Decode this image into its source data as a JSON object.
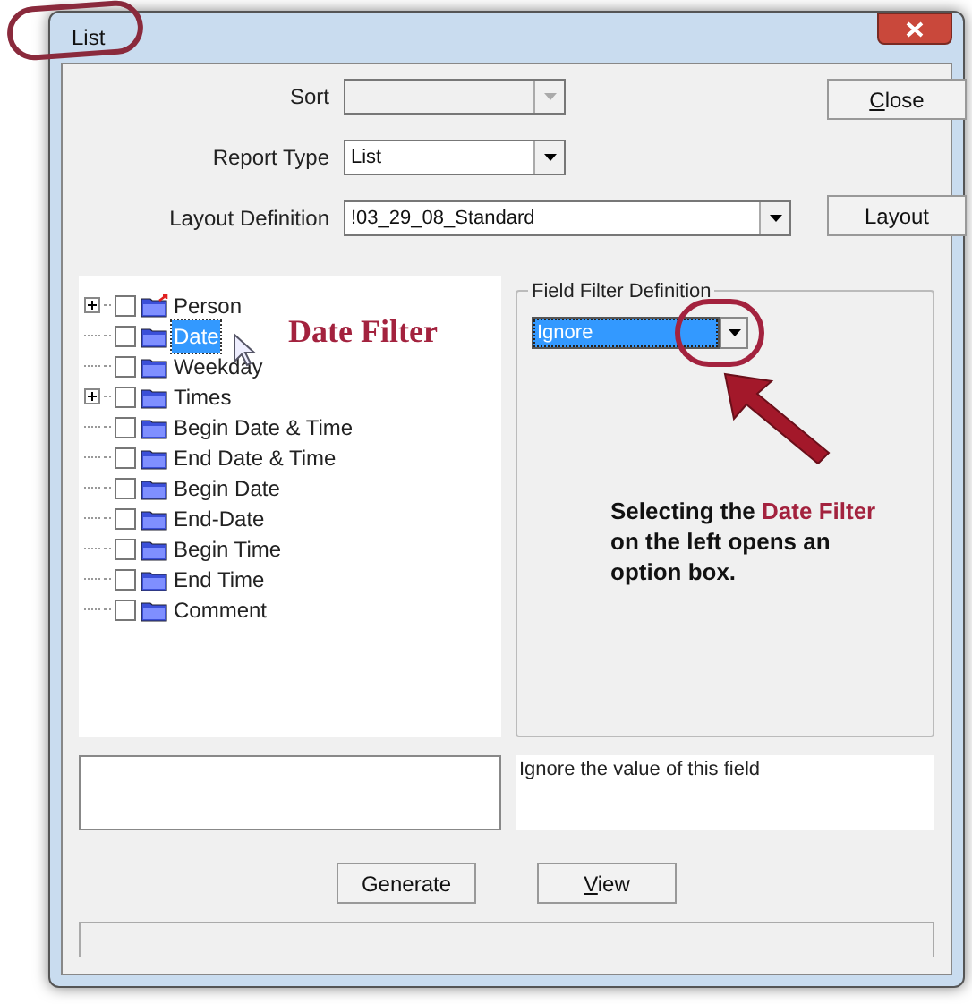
{
  "window": {
    "title": "List"
  },
  "sort": {
    "label": "Sort",
    "disabled": true
  },
  "report_type": {
    "label": "Report Type",
    "value": "List"
  },
  "layout_definition": {
    "label": "Layout Definition",
    "value": "!03_29_08_Standard"
  },
  "buttons_right": [
    {
      "mnemonic": "C",
      "label": "lose"
    },
    {
      "label": "Layout"
    }
  ],
  "tree": [
    {
      "label": "Person",
      "expandable": true,
      "checked": false,
      "selected": false,
      "kind": "linked"
    },
    {
      "label": "Date",
      "expandable": false,
      "checked": false,
      "selected": true,
      "kind": "folder"
    },
    {
      "label": "Weekday",
      "expandable": false,
      "checked": false,
      "selected": false,
      "kind": "folder"
    },
    {
      "label": "Times",
      "expandable": true,
      "checked": false,
      "selected": false,
      "kind": "folder"
    },
    {
      "label": "Begin Date & Time",
      "expandable": false,
      "checked": false,
      "selected": false,
      "kind": "folder"
    },
    {
      "label": "End Date & Time",
      "expandable": false,
      "checked": false,
      "selected": false,
      "kind": "folder"
    },
    {
      "label": "Begin Date",
      "expandable": false,
      "checked": false,
      "selected": false,
      "kind": "folder"
    },
    {
      "label": "End-Date",
      "expandable": false,
      "checked": false,
      "selected": false,
      "kind": "folder"
    },
    {
      "label": "Begin Time",
      "expandable": false,
      "checked": false,
      "selected": false,
      "kind": "folder"
    },
    {
      "label": "End Time",
      "expandable": false,
      "checked": false,
      "selected": false,
      "kind": "folder"
    },
    {
      "label": "Comment",
      "expandable": false,
      "checked": false,
      "selected": false,
      "kind": "folder"
    }
  ],
  "callout_label": "Date Filter",
  "field_filter": {
    "title": "Field Filter Definition",
    "value": "Ignore"
  },
  "annotation": [
    {
      "text": "Selecting the ",
      "highlight": false
    },
    {
      "text": "Date Filter",
      "highlight": true
    },
    {
      "text": " on the left opens an option box.",
      "highlight": false
    }
  ],
  "description": "Ignore the value of this field",
  "buttons_bottom": [
    {
      "label": "Generate"
    },
    {
      "mnemonic": "V",
      "label": "iew"
    }
  ]
}
